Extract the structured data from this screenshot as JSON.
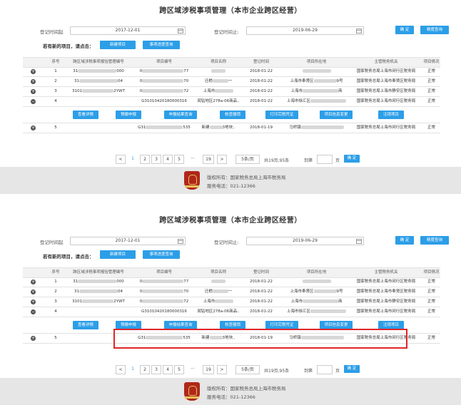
{
  "title": "跨区域涉税事项管理（本市企业跨区经营）",
  "filters": {
    "start_label": "登记时间起",
    "start_value": "2017-12-01",
    "end_label": "登记时间止:",
    "end_value": "2019-06-29",
    "confirm": "确 定",
    "advanced": "精度查询"
  },
  "new_project": {
    "prompt": "若有新的项目，请点击：",
    "create": "新建项目",
    "progress": "事项进度查询"
  },
  "columns": [
    "序号",
    "跨区域涉税事项报验管理编号",
    "项目编号",
    "项目名称",
    "登记时间",
    "项目所在地",
    "主管税务机关",
    "项目情况"
  ],
  "rows": [
    {
      "seq": "1",
      "code_pre": "31",
      "code_suf": "000",
      "proj_pre": "0",
      "proj_suf": "77",
      "name_pre": "",
      "name_suf": "",
      "date": "2018-01-22",
      "loc_pre": "",
      "loc_suf": "",
      "auth": "国家税务总局上海市闵行区税务局",
      "status": "正常",
      "expand": "+"
    },
    {
      "seq": "2",
      "code_pre": "31",
      "code_suf": "04",
      "proj_pre": "0",
      "proj_suf": "70",
      "name_pre": "迁梢",
      "name_suf": "一",
      "date": "2018-01-22",
      "loc_pre": "上海市奉贤区",
      "loc_suf": "9号",
      "auth": "国家税务总局上海市奉贤区税务局",
      "status": "正常",
      "expand": "+"
    },
    {
      "seq": "3",
      "code_pre": "3101",
      "code_suf": "2YWT",
      "proj_pre": "0",
      "proj_suf": "72",
      "name_pre": "上海市",
      "name_suf": "",
      "date": "2018-01-22",
      "loc_pre": "上海市",
      "loc_suf": "商",
      "auth": "国家税务总局上海市静安区税务局",
      "status": "正常",
      "expand": "+"
    },
    {
      "seq": "4",
      "code_pre": "",
      "code_suf": "",
      "proj_pre": "G3101042018000031",
      "proj_suf": "6",
      "name_pre": "闻钻地区278a-06商品..",
      "name_suf": "",
      "date": "2018-01-22",
      "loc_pre": "上海市徐汇区",
      "loc_suf": "",
      "auth": "国家税务总局上海市闵行区税务局",
      "status": "正常",
      "expand": "−"
    },
    {
      "seq": "5",
      "code_pre": "",
      "code_suf": "",
      "proj_pre": "G31",
      "proj_suf": "535",
      "name_pre": "新建",
      "name_suf": "3地块..",
      "date": "2018-01-19",
      "loc_pre": "马桥镇",
      "loc_suf": "",
      "auth": "国家税务总局上海市闵行区税务局",
      "status": "正常",
      "expand": "+"
    }
  ],
  "actions": [
    "查看详情",
    "预缴申报",
    "申报结果查询",
    "核查撤销",
    "打印完税凭证",
    "项目信息变更",
    "注销项目"
  ],
  "pagination": {
    "pages": [
      "1",
      "2",
      "3",
      "4",
      "5",
      "···",
      "19"
    ],
    "prev": "<",
    "next": ">",
    "page_size": "5条/页",
    "summary": "共19页,95条",
    "goto": "到第",
    "page_unit": "页",
    "confirm": "确 定"
  },
  "footer": {
    "copyright": "版权所有：国家税务总局上海市税务局",
    "phone": "服务电话：021-12366"
  },
  "colors": {
    "accent": "#2c9ee8",
    "highlight": "#e0262a",
    "footer_bg": "#e6e6e6"
  }
}
